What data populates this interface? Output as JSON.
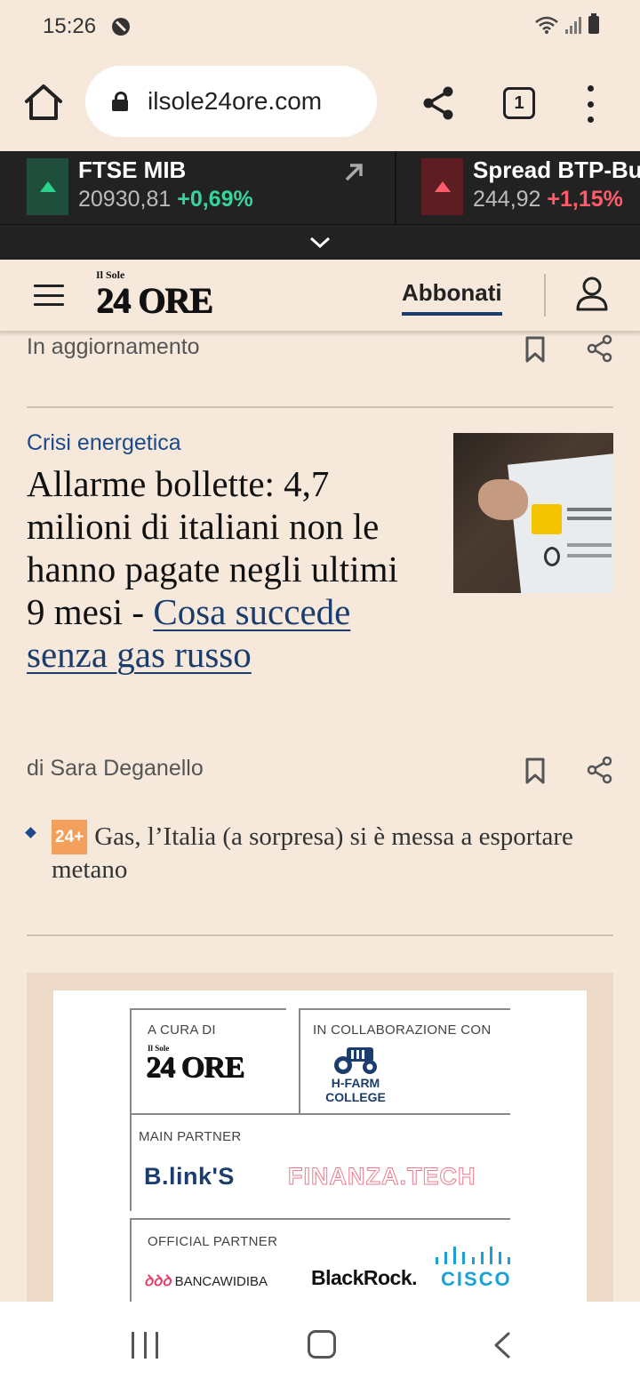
{
  "status_bar": {
    "time": "15:26"
  },
  "browser": {
    "url": "ilsole24ore.com",
    "tab_count": "1"
  },
  "ticker": [
    {
      "name": "FTSE MIB",
      "value": "20930,81",
      "change": "+0,69%",
      "trend": "up"
    },
    {
      "name": "Spread BTP-Bund",
      "value": "244,92",
      "change": "+1,15%",
      "trend": "up"
    }
  ],
  "header": {
    "logo_small": "Il Sole",
    "logo_big": "24 ORE",
    "subscribe_label": "Abbonati"
  },
  "previous_article": {
    "status": "In aggiornamento"
  },
  "article": {
    "kicker": "Crisi energetica",
    "headline": "Allarme bollette: 4,7 milioni di italiani non le hanno pagate negli ultimi 9 mesi - ",
    "headline_link": "Cosa succede senza gas russo",
    "byline": "di Sara Deganello",
    "related": {
      "badge": "24+",
      "text": "Gas, l’Italia (a sorpresa) si è messa a esportare metano"
    }
  },
  "ad": {
    "curated_label": "A CURA DI",
    "logo_small": "Il Sole",
    "logo_big": "24 ORE",
    "collab_label": "IN COLLABORAZIONE CON",
    "hfarm_line1": "H-FARM",
    "hfarm_line2": "COLLEGE",
    "main_partner_label": "MAIN PARTNER",
    "blinks": "B.link'S",
    "finanza": "FINANZA.TECH",
    "official_partner_label": "OFFICIAL PARTNER",
    "widiba_symbol": "ꝺꝺꝺ",
    "widiba": "BANCAWIDIBA",
    "blackrock": "BlackRock.",
    "cisco": "CISCO"
  },
  "colors": {
    "background": "#f6e9dc",
    "ticker_bg": "#222222",
    "positive": "#36d39b",
    "negative": "#ff5b6a",
    "link_blue": "#1a3d6e"
  },
  "icons": [
    "home-icon",
    "lock-icon",
    "share-icon",
    "tabs-icon",
    "more-vert-icon",
    "trend-up-icon",
    "external-arrow-icon",
    "chevron-down-icon",
    "hamburger-icon",
    "user-icon",
    "bookmark-icon",
    "share-icon",
    "diamond-bullet-icon",
    "nav-recent-icon",
    "nav-home-icon",
    "nav-back-icon"
  ]
}
